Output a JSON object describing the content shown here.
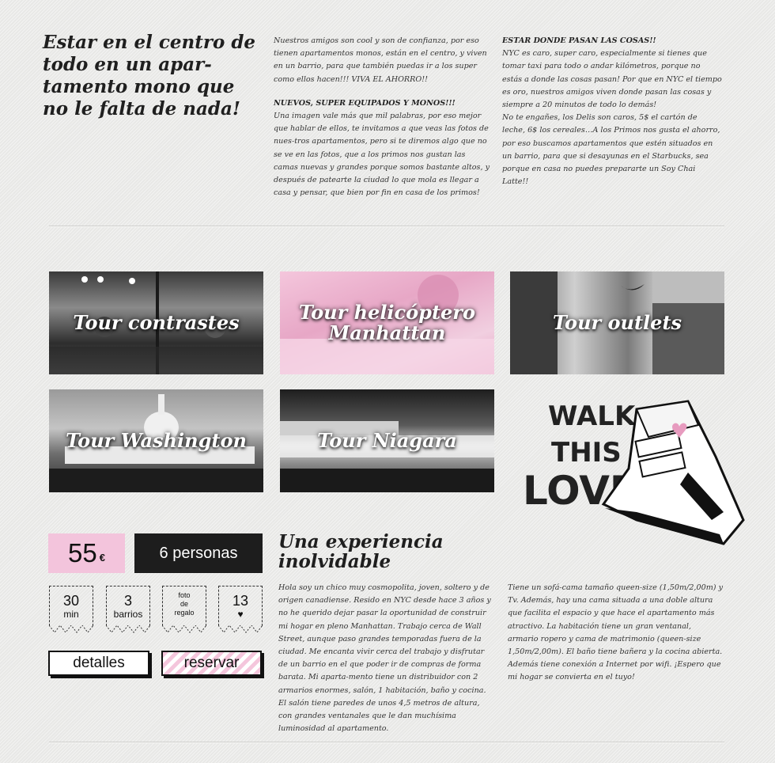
{
  "intro": {
    "headline": "Estar en el centro de todo en un apar-tamento mono que no le falta de nada!",
    "col1": {
      "p1": "Nuestros amigos son cool y son de confianza, por eso tienen apartamentos monos,  están en el centro, y viven en un barrio, para que también puedas ir a los super como ellos hacen!!! VIVA EL AHORRO!!",
      "subtitle": "NUEVOS, SUPER EQUIPADOS Y MONOS!!!",
      "p2": "Una imagen vale más que mil palabras, por eso mejor que hablar de ellos, te invitamos a que veas las fotos de nues-tros apartamentos, pero si te diremos algo que no se ve en las fotos, que a los primos nos gustan las camas nuevas y grandes porque somos bastante altos, y después de patearte la ciudad lo que mola es llegar a casa y pensar, que bien por fin en casa de los primos!"
    },
    "col2": {
      "subtitle": "ESTAR DONDE PASAN LAS COSAS!!",
      "p1": "NYC es caro, super caro,  especialmente si tienes que tomar taxi para todo o andar kilómetros, porque no estás a donde las cosas pasan! Por que en NYC el tiempo es oro, nuestros amigos viven donde pasan las cosas y siempre a 20 minutos de todo lo demás!",
      "p2": "No te engañes, los Delis son caros, 5$ el cartón de leche, 6$ los cereales…A los Primos nos gusta el ahorro, por eso buscamos apartamentos que estén situados en un barrio, para que si desayunas en el Starbucks, sea porque en casa no puedes prepararte un Soy Chai Latte!!"
    }
  },
  "tours": [
    {
      "label": "Tour contrastes"
    },
    {
      "label": "Tour helicóptero Manhattan"
    },
    {
      "label": "Tour outlets"
    },
    {
      "label": "Tour Washington"
    },
    {
      "label": "Tour Niagara"
    }
  ],
  "walk_art": {
    "line1": "WALK",
    "line2": "THIS",
    "line3": "LOVE"
  },
  "offer": {
    "price": "55",
    "currency": "€",
    "people": "6 personas",
    "badges": {
      "min_value": "30",
      "min_label": "min",
      "barrios_value": "3",
      "barrios_label": "barrios",
      "foto_l1": "foto",
      "foto_l2": "de",
      "foto_l3": "regalo",
      "likes_value": "13",
      "likes_icon": "heart-icon"
    },
    "detalles_label": "detalles",
    "reservar_label": "reservar"
  },
  "experience": {
    "title": "Una experiencia inolvidable",
    "p_left": "Hola soy un chico muy cosmopolita,  joven, soltero y de origen canadiense. Resido en NYC desde hace 3 años y no he querido dejar pasar la oportunidad de construir mi hogar en pleno Manhattan.  Trabajo cerca de Wall Street, aunque paso grandes temporadas fuera de la ciudad. Me encanta vivir cerca del trabajo y disfrutar de un barrio en el que poder ir de compras de forma barata. Mi aparta-mento tiene un distribuidor con 2 armarios enormes, salón, 1 habitación, baño y cocina. El salón tiene paredes de unos 4,5 metros de altura, con grandes ventanales que le dan muchísima luminosidad al apartamento.",
    "p_right": "Tiene un sofá-cama tamaño queen-size (1,50m/2,00m) y Tv. Además, hay una cama situada a una doble altura que facilita el espacio y que hace el apartamento más atractivo. La habitación tiene un gran ventanal, armario ropero y cama de matrimonio (queen-size 1,50m/2,00m). El baño tiene bañera y la cocina abierta. Además tiene conexión a Internet por wifi. ¡Espero que mi hogar se convierta en el tuyo!"
  },
  "colors": {
    "pink": "#f3c4dc",
    "dark": "#1d1d1d",
    "background": "#ededeb"
  }
}
